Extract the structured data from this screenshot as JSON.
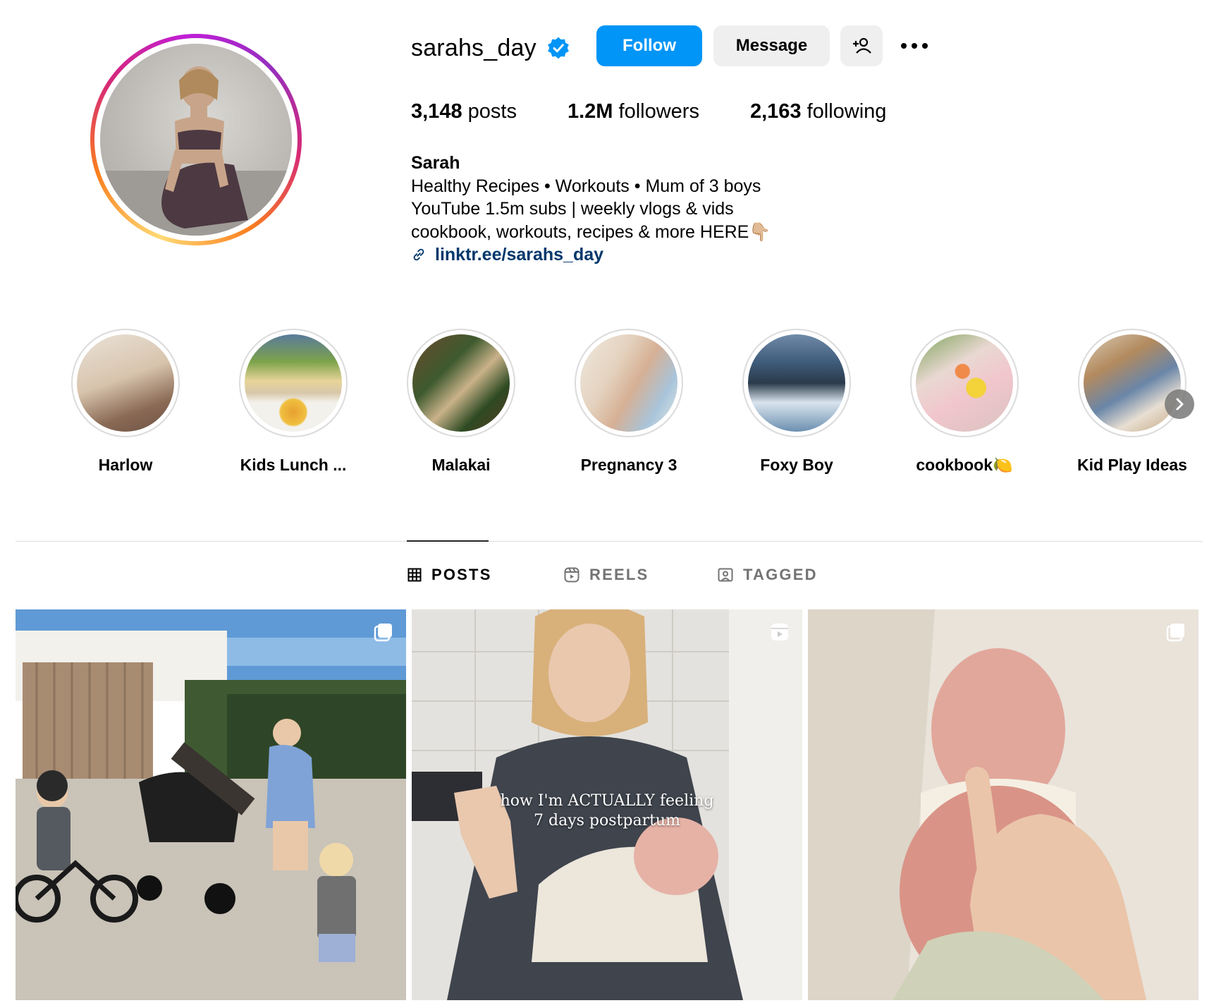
{
  "profile": {
    "username": "sarahs_day",
    "verified": true,
    "follow_label": "Follow",
    "message_label": "Message",
    "stats": {
      "posts_count": "3,148",
      "posts_label": "posts",
      "followers_count": "1.2M",
      "followers_label": "followers",
      "following_count": "2,163",
      "following_label": "following"
    },
    "bio": {
      "name": "Sarah",
      "line1": "Healthy Recipes • Workouts • Mum of 3 boys",
      "line2": "YouTube 1.5m subs | weekly vlogs & vids",
      "line3": "cookbook, workouts, recipes & more HERE👇🏼",
      "link": "linktr.ee/sarahs_day"
    }
  },
  "highlights": [
    {
      "label": "Harlow"
    },
    {
      "label": "Kids Lunch ..."
    },
    {
      "label": "Malakai"
    },
    {
      "label": "Pregnancy 3"
    },
    {
      "label": "Foxy Boy"
    },
    {
      "label": "cookbook🍋"
    },
    {
      "label": "Kid Play Ideas"
    }
  ],
  "tabs": [
    {
      "label": "POSTS",
      "active": true
    },
    {
      "label": "REELS",
      "active": false
    },
    {
      "label": "TAGGED",
      "active": false
    }
  ],
  "posts": [
    {
      "type": "carousel"
    },
    {
      "type": "reel",
      "caption_line1": "how I'm ACTUALLY feeling",
      "caption_line2": "7 days postpartum"
    },
    {
      "type": "carousel"
    }
  ],
  "colors": {
    "follow_button": "#0095f6",
    "link": "#00376b",
    "verified_badge": "#0095f6"
  }
}
